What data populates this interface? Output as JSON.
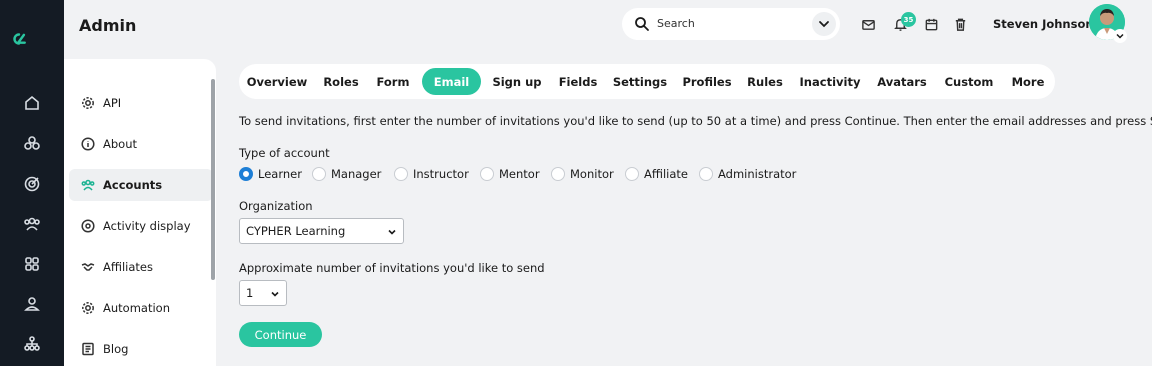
{
  "header": {
    "title": "Admin",
    "search_placeholder": "Search",
    "notification_count": "35",
    "user_name": "Steven Johnson"
  },
  "rail": {
    "icons": [
      "home-icon",
      "modules-icon",
      "target-icon",
      "people-icon",
      "grid-icon",
      "user-icon",
      "org-chart-icon"
    ]
  },
  "sidebar": {
    "items": [
      {
        "label": "API",
        "icon": "gear-icon"
      },
      {
        "label": "About",
        "icon": "info-icon"
      },
      {
        "label": "Accounts",
        "icon": "accounts-icon",
        "active": true
      },
      {
        "label": "Activity display",
        "icon": "target-icon"
      },
      {
        "label": "Affiliates",
        "icon": "handshake-icon"
      },
      {
        "label": "Automation",
        "icon": "gear-icon"
      },
      {
        "label": "Blog",
        "icon": "blog-icon"
      }
    ]
  },
  "tabs": [
    {
      "label": "Overview"
    },
    {
      "label": "Roles"
    },
    {
      "label": "Form"
    },
    {
      "label": "Email",
      "active": true
    },
    {
      "label": "Sign up"
    },
    {
      "label": "Fields"
    },
    {
      "label": "Settings"
    },
    {
      "label": "Profiles"
    },
    {
      "label": "Rules"
    },
    {
      "label": "Inactivity"
    },
    {
      "label": "Avatars"
    },
    {
      "label": "Custom"
    },
    {
      "label": "More"
    }
  ],
  "content": {
    "instructions": "To send invitations, first enter the number of invitations you'd like to send (up to 50 at a time) and press Continue. Then enter the email addresses and press Send.",
    "account_type_label": "Type of account",
    "account_types": [
      "Learner",
      "Manager",
      "Instructor",
      "Mentor",
      "Monitor",
      "Affiliate",
      "Administrator"
    ],
    "selected_account_type": "Learner",
    "organization_label": "Organization",
    "organization_value": "CYPHER Learning",
    "count_label": "Approximate number of invitations you'd like to send",
    "count_value": "1",
    "continue_label": "Continue"
  },
  "colors": {
    "accent": "#2ac5a0",
    "rail": "#141b24",
    "radio_selected": "#1e7fd6",
    "background": "#f1f2f4"
  }
}
